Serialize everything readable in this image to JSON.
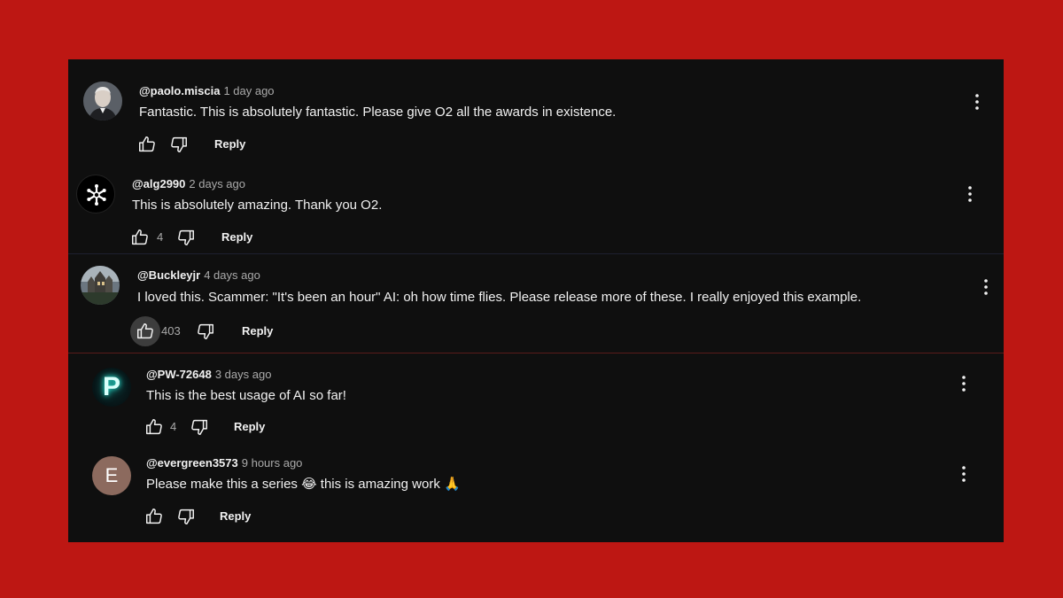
{
  "comments": [
    {
      "author": "@paolo.miscia",
      "time": "1 day ago",
      "text": "Fantastic. This is absolutely fantastic. Please give O2 all the awards in existence.",
      "likes": "",
      "reply_label": "Reply"
    },
    {
      "author": "@alg2990",
      "time": "2 days ago",
      "text": "This is absolutely amazing. Thank you O2.",
      "likes": "4",
      "reply_label": "Reply"
    },
    {
      "author": "@Buckleyjr",
      "time": "4 days ago",
      "text": "I loved this. Scammer: \"It's been an hour\" AI: oh how time flies. Please release more of these. I really enjoyed this example.",
      "likes": "403",
      "reply_label": "Reply"
    },
    {
      "author": "@PW-72648",
      "time": "3 days ago",
      "text": "This is the best usage of AI so far!",
      "likes": "4",
      "reply_label": "Reply",
      "avatar_letter": "P"
    },
    {
      "author": "@evergreen3573",
      "time": "9 hours ago",
      "text": "Please make this a series 😂 this is amazing work 🙏",
      "likes": "",
      "reply_label": "Reply",
      "avatar_letter": "E"
    }
  ],
  "icons": {
    "like": "thumbs-up-icon",
    "dislike": "thumbs-down-icon",
    "menu": "more-vertical-icon",
    "snowflake": "snowflake-icon"
  },
  "colors": {
    "page_background": "#bd1713",
    "panel_background": "#0f0f0f",
    "text_primary": "#f1f1f1",
    "text_secondary": "#aaaaaa",
    "avatar_e": "#8c6a5e"
  }
}
